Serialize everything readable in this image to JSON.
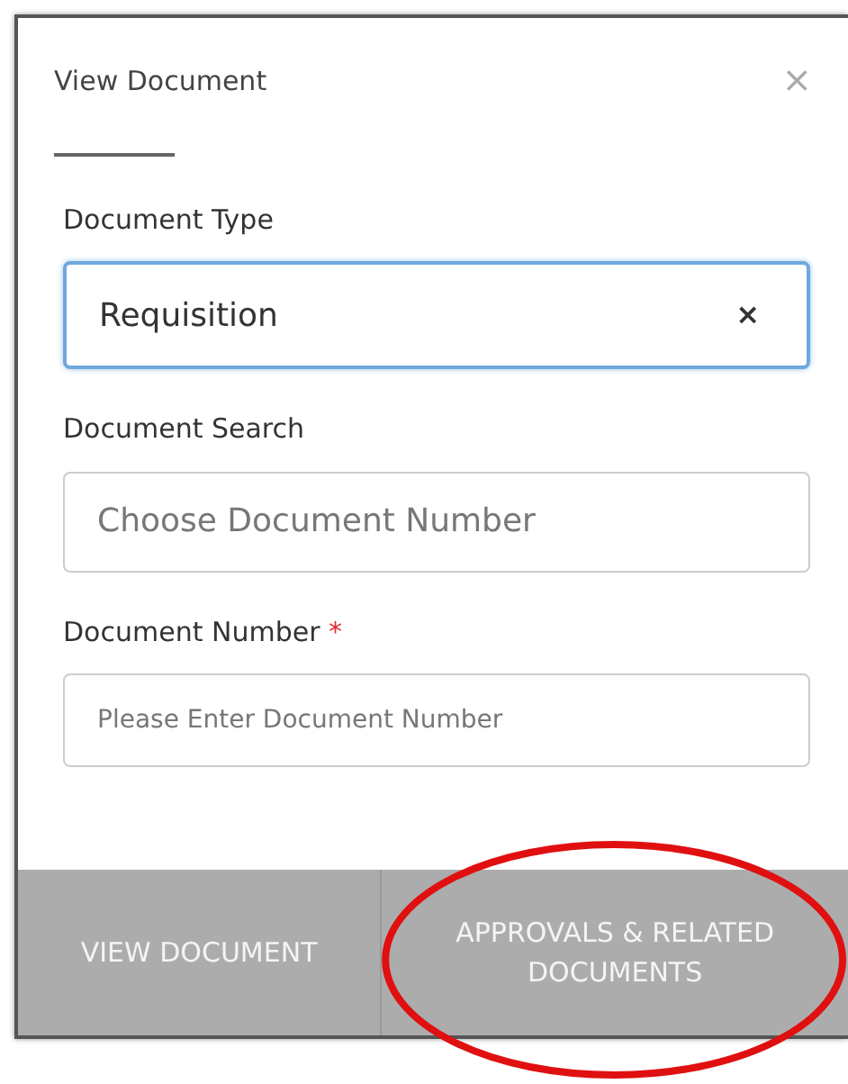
{
  "dialog": {
    "title": "View Document",
    "close": "×"
  },
  "fields": [
    {
      "label": "Document Type",
      "value": "Requisition",
      "focused": true,
      "clear": "×"
    },
    {
      "label": "Document Search",
      "placeholder": "Choose Document Number",
      "focused": false
    },
    {
      "label": "Document Number",
      "required_mark": "*",
      "placeholder": "Please Enter Document Number",
      "focused": false,
      "small": true
    }
  ],
  "footer_buttons": [
    {
      "label": "VIEW DOCUMENT",
      "highlighted": false
    },
    {
      "label": "APPROVALS & RELATED DOCUMENTS",
      "highlighted": true
    }
  ]
}
